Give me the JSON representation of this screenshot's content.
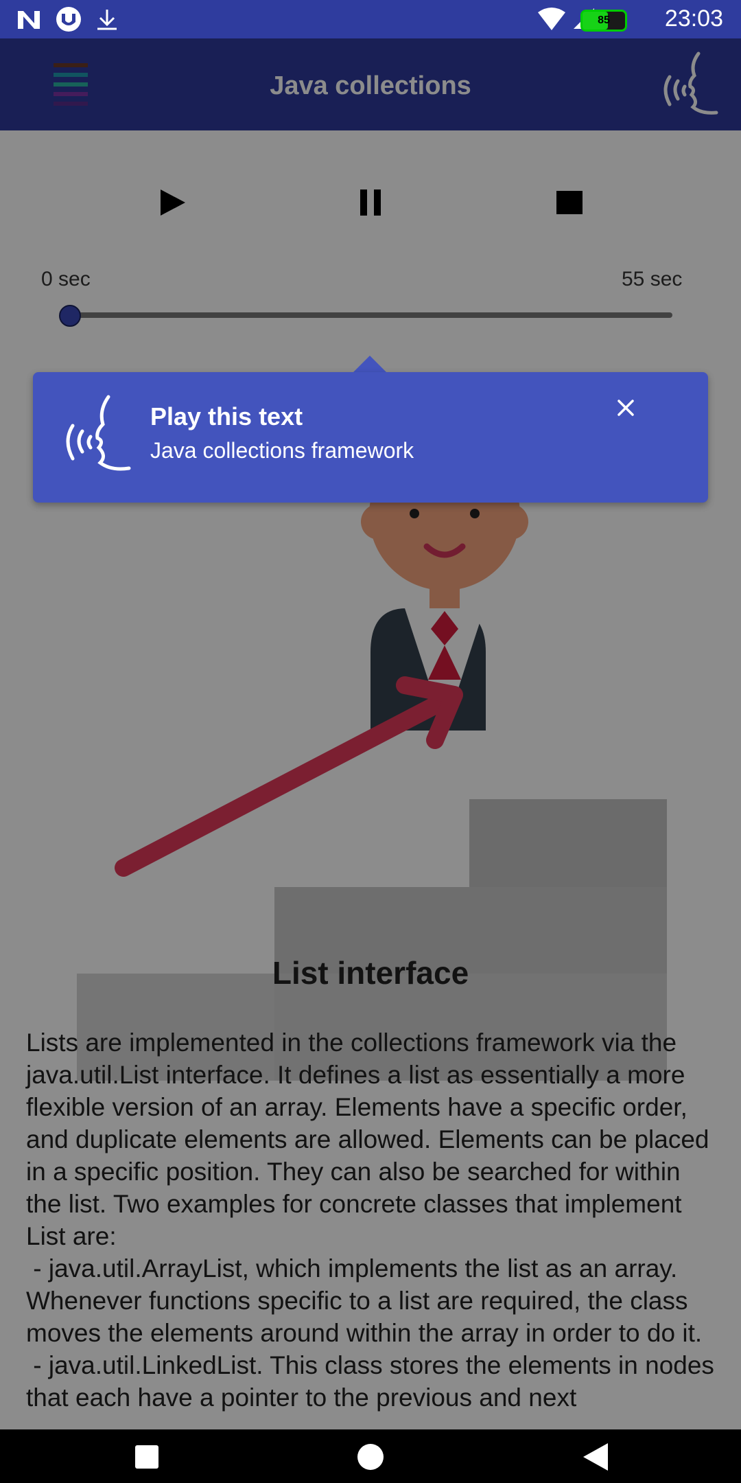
{
  "status_bar": {
    "time": "23:03",
    "battery": "85"
  },
  "app_bar": {
    "title": "Java collections"
  },
  "player": {
    "start_time": "0 sec",
    "end_time": "55 sec",
    "progress": 0.01
  },
  "tooltip": {
    "title": "Play this text",
    "text": "Java collections framework"
  },
  "content": {
    "heading": "List interface",
    "paragraph": "Lists are implemented in the collections framework via the java.util.List interface. It defines a list as essentially a more flexible version of an array. Elements have a specific order, and duplicate elements are allowed. Elements can be placed in a specific position. They can also be searched for within the list. Two examples for concrete classes that implement List are:\n - java.util.ArrayList, which implements the list as an array. Whenever functions specific to a list are required, the class moves the elements around within the array in order to do it.\n - java.util.LinkedList. This class stores the elements in nodes that each have a pointer to the previous and next"
  },
  "colors": {
    "primary": "#2e3a9c",
    "tooltip": "#4354bd",
    "arrow": "#8e2236"
  }
}
